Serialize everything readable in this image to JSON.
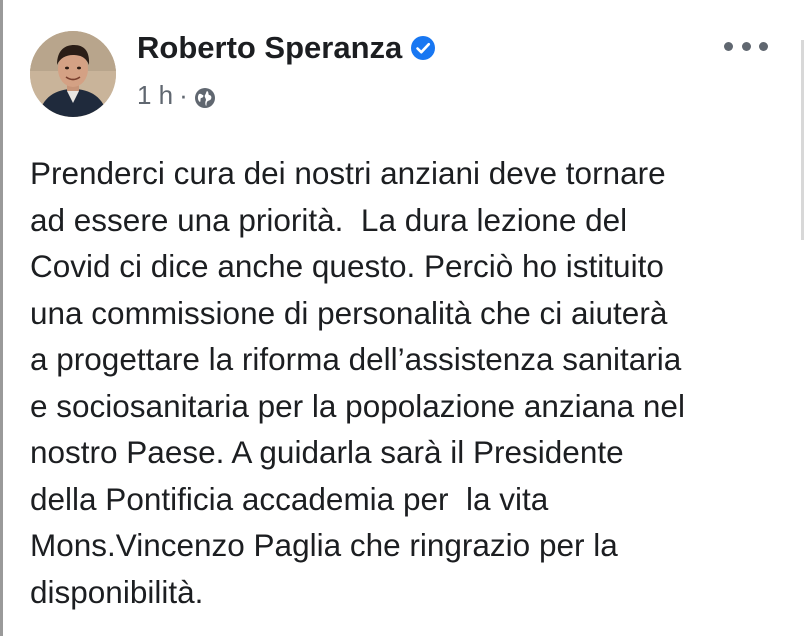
{
  "post": {
    "author": "Roberto Speranza",
    "verified": true,
    "time": "1 h",
    "separator": "·",
    "audience_icon": "globe-icon",
    "more_icon": "more-options-icon",
    "text_lines": [
      "Prenderci cura dei nostri anziani deve tornare",
      "ad essere una priorità.  La dura lezione del",
      "Covid ci dice anche questo. Perciò ho istituito",
      "una commissione di personalità che ci aiuterà",
      "a progettare la riforma dell’assistenza sanitaria",
      "e sociosanitaria per la popolazione anziana nel",
      "nostro Paese. A guidarla sarà il Presidente",
      "della Pontificia accademia per  la vita",
      "Mons.Vincenzo Paglia che ringrazio per la",
      "disponibilità."
    ]
  },
  "colors": {
    "text": "#1c1e21",
    "meta": "#606770",
    "verified_badge": "#1877f2"
  }
}
